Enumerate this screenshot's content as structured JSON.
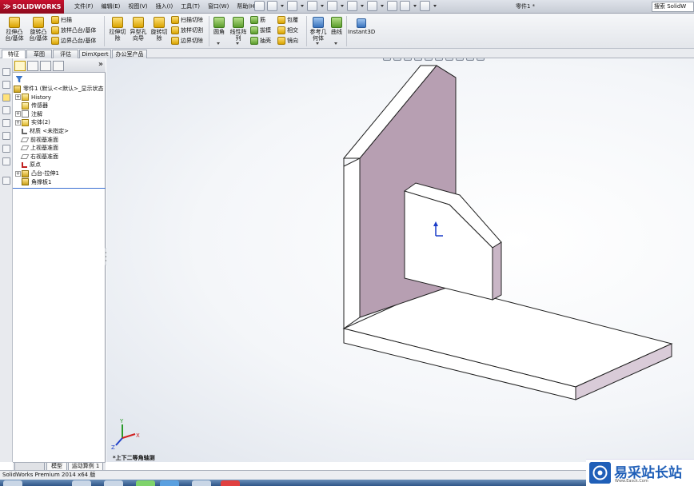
{
  "title_bar": {
    "logo_text": "SOLIDWORKS",
    "menus": [
      "文件(F)",
      "编辑(E)",
      "视图(V)",
      "插入(I)",
      "工具(T)",
      "窗口(W)",
      "帮助(H)"
    ],
    "document_title": "零件1 *",
    "search_text": "搜索 SolidW"
  },
  "command_manager": {
    "extrude_boss": "拉伸凸\n台/基体",
    "revolve_boss": "旋转凸\n台/基体",
    "sweep": "扫描",
    "loft": "放样凸台/基体",
    "boundary_boss": "边界凸台/基体",
    "extrude_cut": "拉伸切\n除",
    "hole_wizard": "异型孔\n向导",
    "revolve_cut": "旋转切\n除",
    "swept_cut": "扫描切除",
    "lofted_cut": "放样切割",
    "boundary_cut": "边界切除",
    "fillet": "圆角",
    "linear_pattern": "线性阵\n列",
    "rib": "筋",
    "draft": "拔模",
    "shell": "抽壳",
    "wrap": "包覆",
    "intersect": "相交",
    "mirror": "镜向",
    "ref_geometry": "参考几\n何体",
    "curves": "曲线",
    "instant3d": "Instant3D"
  },
  "tabs": [
    "特征",
    "草图",
    "评估",
    "DimXpert",
    "办公室产品"
  ],
  "feature_tree": [
    {
      "label": "零件1  (默认<<默认>_显示状态",
      "icon": "part",
      "indent": 0,
      "expander": ""
    },
    {
      "label": "History",
      "icon": "folder",
      "indent": 1,
      "expander": "+"
    },
    {
      "label": "传感器",
      "icon": "folder",
      "indent": 1,
      "expander": ""
    },
    {
      "label": "注解",
      "icon": "annot",
      "indent": 1,
      "expander": "+"
    },
    {
      "label": "实体(2)",
      "icon": "folder",
      "indent": 1,
      "expander": "+"
    },
    {
      "label": "材质 <未指定>",
      "icon": "mat",
      "indent": 1,
      "expander": ""
    },
    {
      "label": "前视基准面",
      "icon": "plane",
      "indent": 1,
      "expander": ""
    },
    {
      "label": "上视基准面",
      "icon": "plane",
      "indent": 1,
      "expander": ""
    },
    {
      "label": "右视基准面",
      "icon": "plane",
      "indent": 1,
      "expander": ""
    },
    {
      "label": "原点",
      "icon": "origin",
      "indent": 1,
      "expander": ""
    },
    {
      "label": "凸台-拉伸1",
      "icon": "part",
      "indent": 1,
      "expander": "+"
    },
    {
      "label": "角撑板1",
      "icon": "part",
      "indent": 1,
      "expander": ""
    }
  ],
  "viewport": {
    "view_label": "*上下二等角轴测",
    "axis_labels": {
      "x": "X",
      "y": "Y",
      "z": "Z"
    }
  },
  "bottom_tabs": [
    "模型",
    "运动算例 1"
  ],
  "status_text": "SolidWorks Premium 2014 x64 版",
  "watermark": {
    "text": "易采站长站",
    "url": "Www.Easck.Com"
  },
  "colors": {
    "accent_red": "#c8102e",
    "model_face": "#ffffff",
    "model_shadow_face": "#b79fb2",
    "model_edge": "#222222",
    "tree_selection_line": "#3a6fd1"
  }
}
